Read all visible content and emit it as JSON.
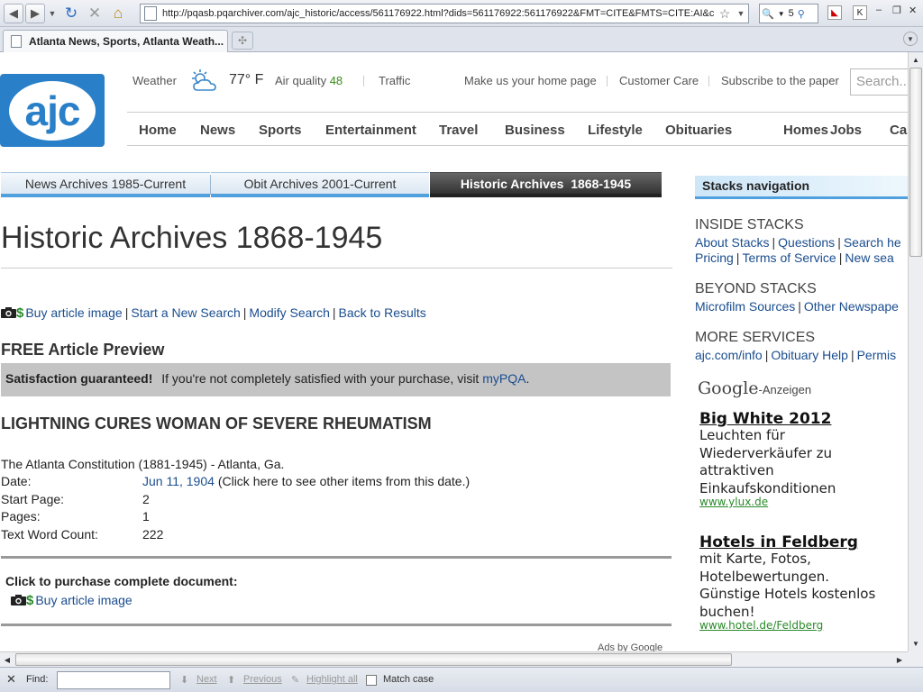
{
  "browser": {
    "url": "http://pqasb.pqarchiver.com/ajc_historic/access/561176922.html?dids=561176922:561176922&FMT=CITE&FMTS=CITE:AI&c",
    "tab_title": "Atlanta News, Sports, Atlanta Weath...",
    "search_engine_glyph": "5",
    "icons": [
      "back-icon",
      "forward-icon",
      "reload-icon",
      "stop-icon",
      "home-icon",
      "star-icon",
      "search-icon",
      "close-icon"
    ]
  },
  "header": {
    "logo_text": "ajc",
    "weather_label": "Weather",
    "temperature": "77° F",
    "air_quality_label": "Air quality",
    "air_quality_value": "48",
    "traffic_label": "Traffic",
    "links": [
      "Make us your home page",
      "Customer Care",
      "Subscribe to the paper"
    ],
    "search_placeholder": "Search..."
  },
  "nav": {
    "items": [
      "Home",
      "News",
      "Sports",
      "Entertainment",
      "Travel",
      "Business",
      "Lifestyle",
      "Obituaries",
      "Homes",
      "Jobs",
      "Ca"
    ]
  },
  "archive_tabs": [
    "News Archives 1985-Current",
    "Obit Archives 2001-Current",
    "Historic Archives  1868-1945"
  ],
  "main": {
    "page_title": "Historic Archives 1868-1945",
    "actions": {
      "dollar": "$",
      "buy_image": "Buy article image",
      "new_search": "Start a New Search",
      "modify_search": "Modify Search",
      "back_results": "Back to Results",
      "pipe": "|"
    },
    "free_preview": "FREE Article Preview",
    "satisfaction": {
      "bold": "Satisfaction guaranteed!",
      "text": "If you're not completely satisfied with your purchase, visit",
      "link": "myPQA",
      "period": "."
    },
    "headline": "LIGHTNING CURES WOMAN OF SEVERE RHEUMATISM",
    "source": "The Atlanta Constitution (1881-1945) - Atlanta, Ga.",
    "meta": {
      "date_label": "Date:",
      "date_value": "Jun 11, 1904",
      "date_note": "(Click here to see other items from this date.)",
      "start_page_label": "Start Page:",
      "start_page_value": "2",
      "pages_label": "Pages:",
      "pages_value": "1",
      "word_count_label": "Text Word Count:",
      "word_count_value": "222"
    },
    "purchase_label": "Click to purchase complete document:",
    "purchase_buy": "Buy article image",
    "ads_by": "Ads by Google"
  },
  "sidebar": {
    "title": "Stacks navigation",
    "inside_head": "INSIDE STACKS",
    "inside_row1": [
      "About Stacks",
      "Questions",
      "Search he"
    ],
    "inside_row2": [
      "Pricing",
      "Terms of Service",
      "New sea"
    ],
    "beyond_head": "BEYOND STACKS",
    "beyond_row": [
      "Microfilm Sources",
      "Other Newspape"
    ],
    "more_head": "MORE SERVICES",
    "more_row": [
      "ajc.com/info",
      "Obituary Help",
      "Permis"
    ],
    "google_text": "Google",
    "google_sub": "-Anzeigen",
    "ads": [
      {
        "title": "Big White 2012",
        "body": "Leuchten für Wiederverkäufer zu attraktiven Einkaufskonditionen",
        "url": "www.ylux.de"
      },
      {
        "title": "Hotels in Feldberg",
        "body": "mit Karte, Fotos, Hotelbewertungen. Günstige Hotels kostenlos buchen!",
        "url": "www.hotel.de/Feldberg"
      }
    ]
  },
  "findbar": {
    "close": "✕",
    "find_label": "Find:",
    "next": "Next",
    "previous": "Previous",
    "highlight": "Highlight all",
    "match_case": "Match case"
  },
  "colors": {
    "brand_blue": "#2a80c8",
    "link": "#1a4d8f",
    "tab_accent": "#4fa0dc",
    "ad_url_green": "#2a8a2a"
  }
}
